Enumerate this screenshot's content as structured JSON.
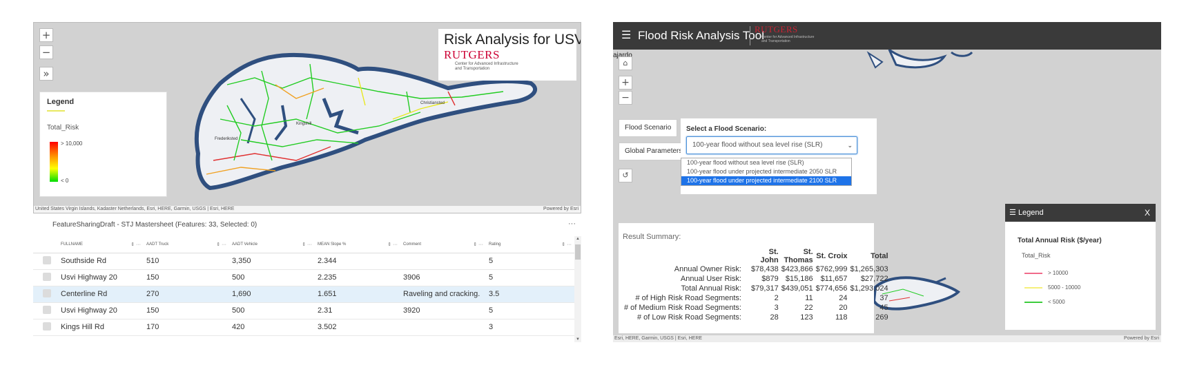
{
  "left": {
    "map": {
      "zoom_in": "+",
      "zoom_out": "−",
      "expand": "»",
      "legend": {
        "title": "Legend",
        "field": "Total_Risk",
        "max_label": "> 10,000",
        "min_label": "< 0"
      },
      "title": "Risk Analysis for USVI",
      "brand": "RUTGERS",
      "brand_sub_1": "Center for Advanced Infrastructure",
      "brand_sub_2": "and Transportation",
      "labels": {
        "frederiksted": "Frederiksted",
        "kingshill": "Kingshill",
        "christiansted": "Christiansted"
      },
      "attribution": "United States Virgin Islands, Kadaster Netherlands, Esri, HERE, Garmin, USGS | Esri, HERE",
      "powered_by": "Powered by Esri"
    },
    "table": {
      "title": "FeatureSharingDraft - STJ Mastersheet (Features: 33, Selected: 0)",
      "menu": "···",
      "columns": [
        "FULLNAME",
        "AADT Truck",
        "AADT Vehicle",
        "MEAN Slope %",
        "Comment",
        "Rating"
      ],
      "rows": [
        [
          "Southside Rd",
          "510",
          "3,350",
          "2.344",
          "",
          "5"
        ],
        [
          "Usvi Highway 20",
          "150",
          "500",
          "2.235",
          "3906",
          "5"
        ],
        [
          "Centerline Rd",
          "270",
          "1,690",
          "1.651",
          "Raveling and cracking.",
          "3.5"
        ],
        [
          "Usvi Highway 20",
          "150",
          "500",
          "2.31",
          "3920",
          "5"
        ],
        [
          "Kings Hill Rd",
          "170",
          "420",
          "3.502",
          "",
          "3"
        ]
      ]
    }
  },
  "right": {
    "app_title": "Flood Risk Analysis Tool",
    "brand": "RUTGERS",
    "brand_sub_1": "Center for Advanced Infrastructure",
    "brand_sub_2": "and Transportation",
    "place_label": "ajardo",
    "tabs": {
      "flood_scenario": "Flood Scenario",
      "global_parameters": "Global Parameters"
    },
    "scenario": {
      "label": "Select a Flood Scenario:",
      "selected": "100-year flood without sea level rise (SLR)",
      "options": [
        "100-year flood without sea level rise (SLR)",
        "100-year flood under projected intermediate 2050 SLR",
        "100-year flood under projected intermediate 2100 SLR"
      ]
    },
    "summary": {
      "title": "Result Summary:",
      "headers": [
        "",
        "St. John",
        "St. Thomas",
        "St. Croix",
        "Total"
      ],
      "rows": [
        [
          "Annual Owner Risk:",
          "$78,438",
          "$423,866",
          "$762,999",
          "$1,265,303"
        ],
        [
          "Annual User Risk:",
          "$879",
          "$15,186",
          "$11,657",
          "$27,722"
        ],
        [
          "Total Annual Risk:",
          "$79,317",
          "$439,051",
          "$774,656",
          "$1,293,024"
        ],
        [
          "# of High Risk Road Segments:",
          "2",
          "11",
          "24",
          "37"
        ],
        [
          "# of Medium Risk Road Segments:",
          "3",
          "22",
          "20",
          "45"
        ],
        [
          "# of Low Risk Road Segments:",
          "28",
          "123",
          "118",
          "269"
        ]
      ]
    },
    "legend": {
      "header": "Legend",
      "close": "X",
      "title": "Total Annual Risk ($/year)",
      "field": "Total_Risk",
      "items": [
        {
          "label": "> 10000",
          "color": "#f06a8a"
        },
        {
          "label": "5000 - 10000",
          "color": "#f5f07a"
        },
        {
          "label": "< 5000",
          "color": "#3ccc3c"
        }
      ]
    },
    "attribution": "Esri, HERE, Garmin, USGS | Esri, HERE",
    "powered_by": "Powered by Esri"
  }
}
